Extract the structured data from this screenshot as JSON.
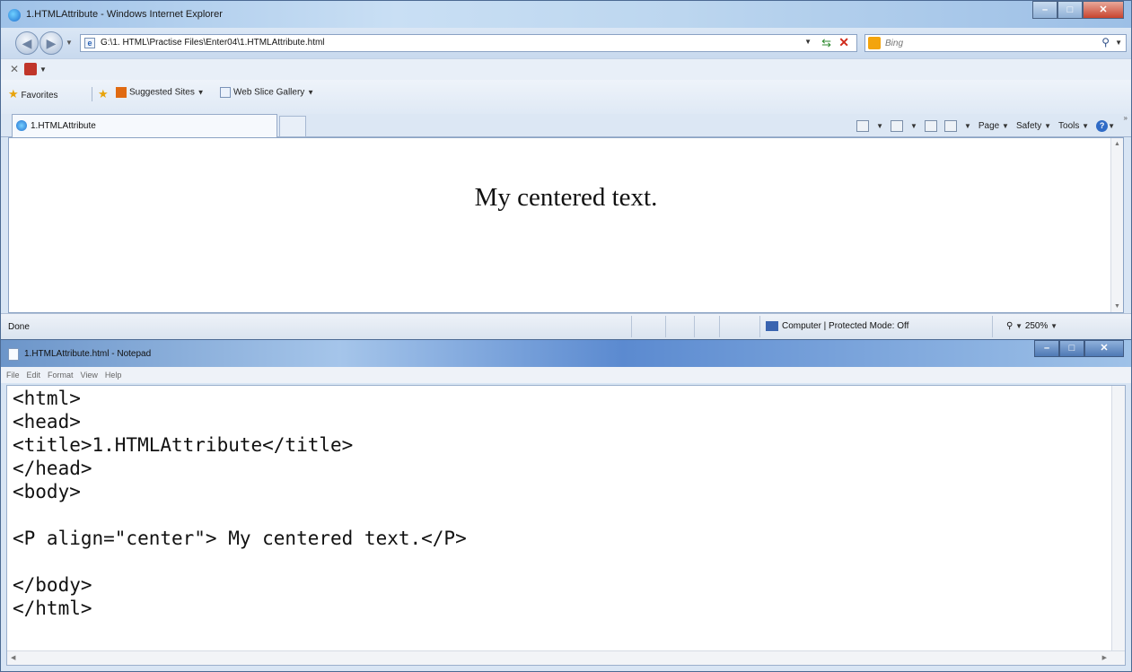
{
  "ie": {
    "window_title": "1.HTMLAttribute - Windows Internet Explorer",
    "address": "G:\\1. HTML\\Practise Files\\Enter04\\1.HTMLAttribute.html",
    "search_placeholder": "Bing",
    "favorites": {
      "favorites_label": "Favorites",
      "suggested_sites_label": "Suggested Sites",
      "web_slice_label": "Web Slice Gallery"
    },
    "tab_title": "1.HTMLAttribute",
    "command_bar": {
      "page_label": "Page",
      "safety_label": "Safety",
      "tools_label": "Tools"
    },
    "page_text": "My centered text.",
    "status": {
      "left": "Done",
      "zone": "Computer | Protected Mode: Off",
      "zoom": "250%"
    }
  },
  "notepad": {
    "window_title": "1.HTMLAttribute.html - Notepad",
    "menu": [
      "File",
      "Edit",
      "Format",
      "View",
      "Help"
    ],
    "lines": [
      "<html>",
      "<head>",
      "<title>1.HTMLAttribute</title>",
      "</head>",
      "<body>",
      "",
      "<P align=\"center\"> My centered text.</P>",
      "",
      "</body>",
      "</html>"
    ]
  },
  "colors": {
    "titlebar_blue": "#9fc2e8",
    "close_red": "#c7452f",
    "status_zone": "#3a64b0"
  }
}
